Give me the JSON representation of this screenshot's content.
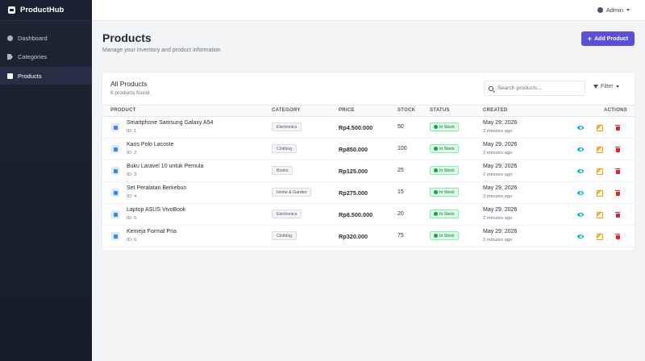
{
  "brand": {
    "name": "ProductHub",
    "logo_icon": "box-logo-icon"
  },
  "sidebar": {
    "items": [
      {
        "label": "Dashboard",
        "icon": "dashboard-icon",
        "active": false
      },
      {
        "label": "Categories",
        "icon": "tag-icon",
        "active": false
      },
      {
        "label": "Products",
        "icon": "box-icon",
        "active": true
      }
    ]
  },
  "topbar": {
    "user_label": "Admin",
    "user_icon": "user-circle-icon"
  },
  "page": {
    "title": "Products",
    "subtitle": "Manage your inventory and product information",
    "add_button_label": "Add Product",
    "add_button_color": "#5b4fd8"
  },
  "card": {
    "title": "All Products",
    "count_text": "6 products found",
    "search_placeholder": "Search products...",
    "filter_label": "Filter"
  },
  "table": {
    "columns": [
      "PRODUCT",
      "CATEGORY",
      "PRICE",
      "STOCK",
      "STATUS",
      "CREATED",
      "ACTIONS"
    ],
    "rows": [
      {
        "name": "Smartphone Samsung Galaxy A54",
        "id": "ID: 1",
        "category": "Electronics",
        "price": "Rp4.500.000",
        "stock": "50",
        "status": "In Stock",
        "created_date": "May 29, 2026",
        "created_ago": "2 minutes ago"
      },
      {
        "name": "Kaos Polo Lacoste",
        "id": "ID: 2",
        "category": "Clothing",
        "price": "Rp850.000",
        "stock": "100",
        "status": "In Stock",
        "created_date": "May 29, 2026",
        "created_ago": "2 minutes ago"
      },
      {
        "name": "Buku Laravel 10 untuk Pemula",
        "id": "ID: 3",
        "category": "Books",
        "price": "Rp125.000",
        "stock": "25",
        "status": "In Stock",
        "created_date": "May 29, 2026",
        "created_ago": "2 minutes ago"
      },
      {
        "name": "Set Peralatan Berkebun",
        "id": "ID: 4",
        "category": "Home & Garden",
        "price": "Rp275.000",
        "stock": "15",
        "status": "In Stock",
        "created_date": "May 29, 2026",
        "created_ago": "2 minutes ago"
      },
      {
        "name": "Laptop ASUS VivoBook",
        "id": "ID: 5",
        "category": "Electronics",
        "price": "Rp8.500.000",
        "stock": "20",
        "status": "In Stock",
        "created_date": "May 29, 2026",
        "created_ago": "2 minutes ago"
      },
      {
        "name": "Kemeja Formal Pria",
        "id": "ID: 6",
        "category": "Clothing",
        "price": "Rp320.000",
        "stock": "75",
        "status": "In Stock",
        "created_date": "May 29, 2026",
        "created_ago": "2 minutes ago"
      }
    ],
    "action_icons": [
      "eye-icon",
      "edit-icon",
      "trash-icon"
    ],
    "status_color": "#16a34a"
  }
}
